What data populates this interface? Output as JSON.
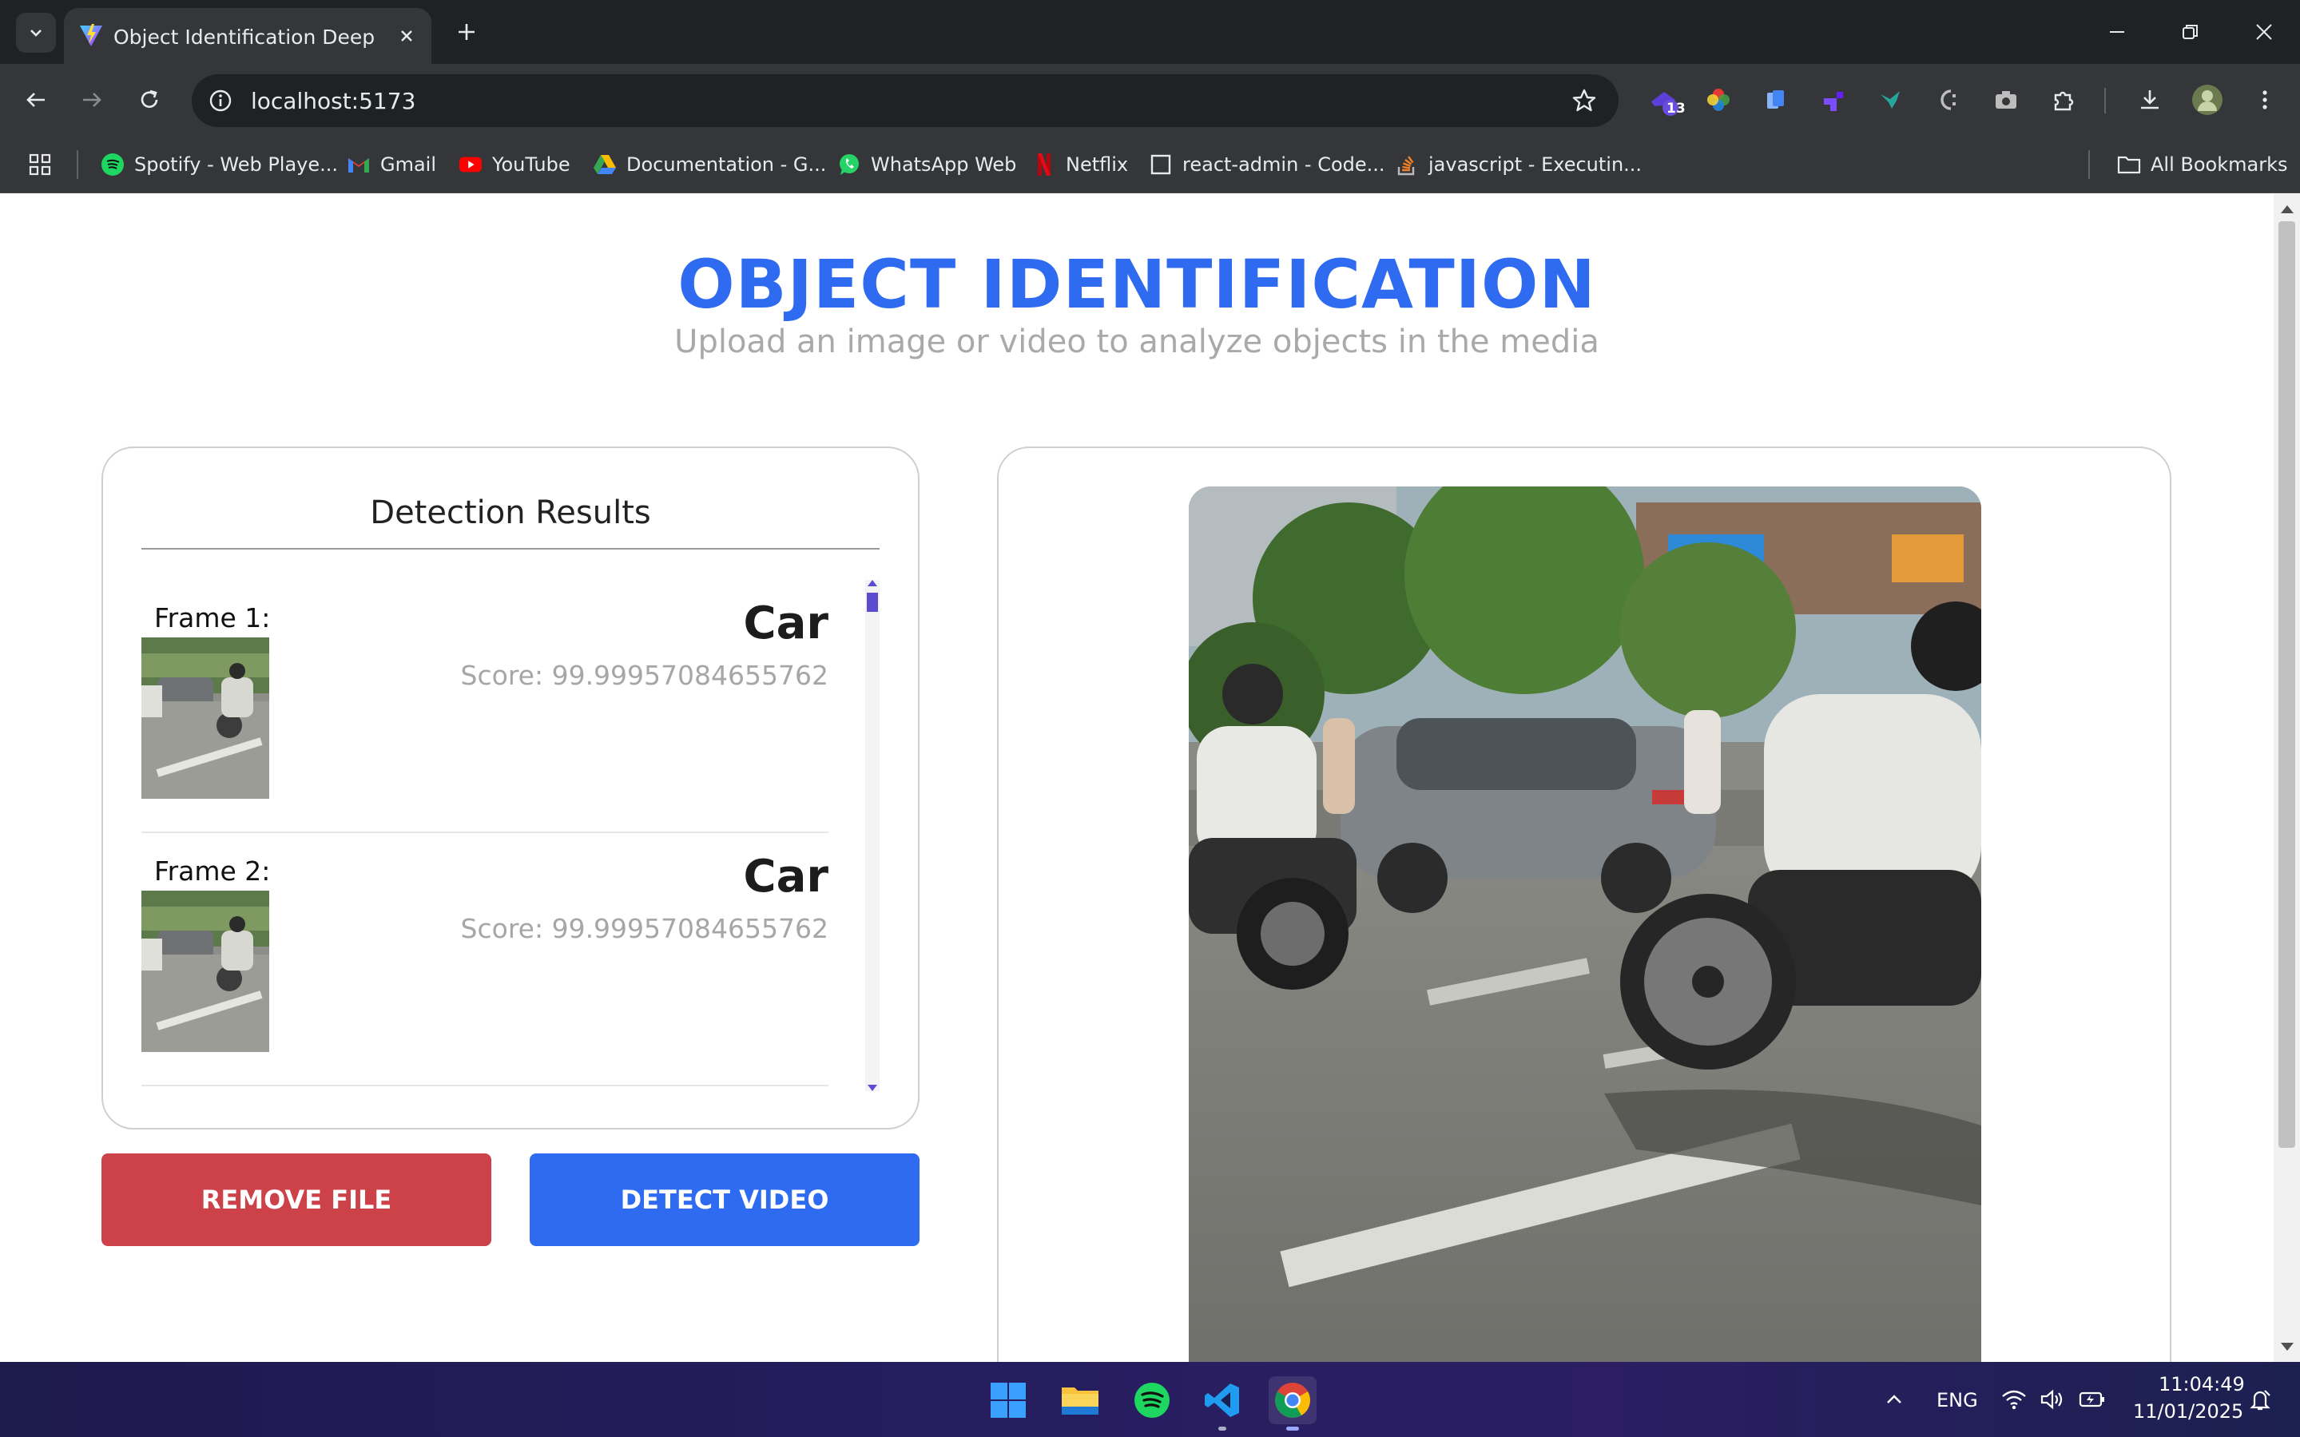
{
  "browser": {
    "tab": {
      "title": "Object Identification Deep Learn"
    },
    "address_bar": {
      "url": "localhost:5173"
    },
    "extensions": {
      "badge_count": "13"
    },
    "bookmarks": [
      {
        "label": "Spotify - Web Playe...",
        "icon": "spotify-icon"
      },
      {
        "label": "Gmail",
        "icon": "gmail-icon"
      },
      {
        "label": "YouTube",
        "icon": "youtube-icon"
      },
      {
        "label": "Documentation - G...",
        "icon": "google-drive-icon"
      },
      {
        "label": "WhatsApp Web",
        "icon": "whatsapp-icon"
      },
      {
        "label": "Netflix",
        "icon": "netflix-icon"
      },
      {
        "label": "react-admin - Code...",
        "icon": "codesandbox-icon"
      },
      {
        "label": "javascript - Executin...",
        "icon": "stackoverflow-icon"
      }
    ],
    "all_bookmarks_label": "All Bookmarks"
  },
  "page": {
    "title": "OBJECT IDENTIFICATION",
    "subtitle": "Upload an image or video to analyze objects in the media",
    "results": {
      "heading": "Detection Results",
      "frames": [
        {
          "label": "Frame 1:",
          "class_name": "Car",
          "score": "Score: 99.99957084655762"
        },
        {
          "label": "Frame 2:",
          "class_name": "Car",
          "score": "Score: 99.99957084655762"
        }
      ]
    },
    "buttons": {
      "remove": "REMOVE FILE",
      "detect": "DETECT VIDEO"
    }
  },
  "taskbar": {
    "language": "ENG",
    "time": "11:04:49",
    "date": "11/01/2025"
  },
  "colors": {
    "accent_blue": "#2f6bf0",
    "remove_red": "#cd4149",
    "subtitle_gray": "#a9a9a9",
    "chrome_dark": "#35363a"
  }
}
